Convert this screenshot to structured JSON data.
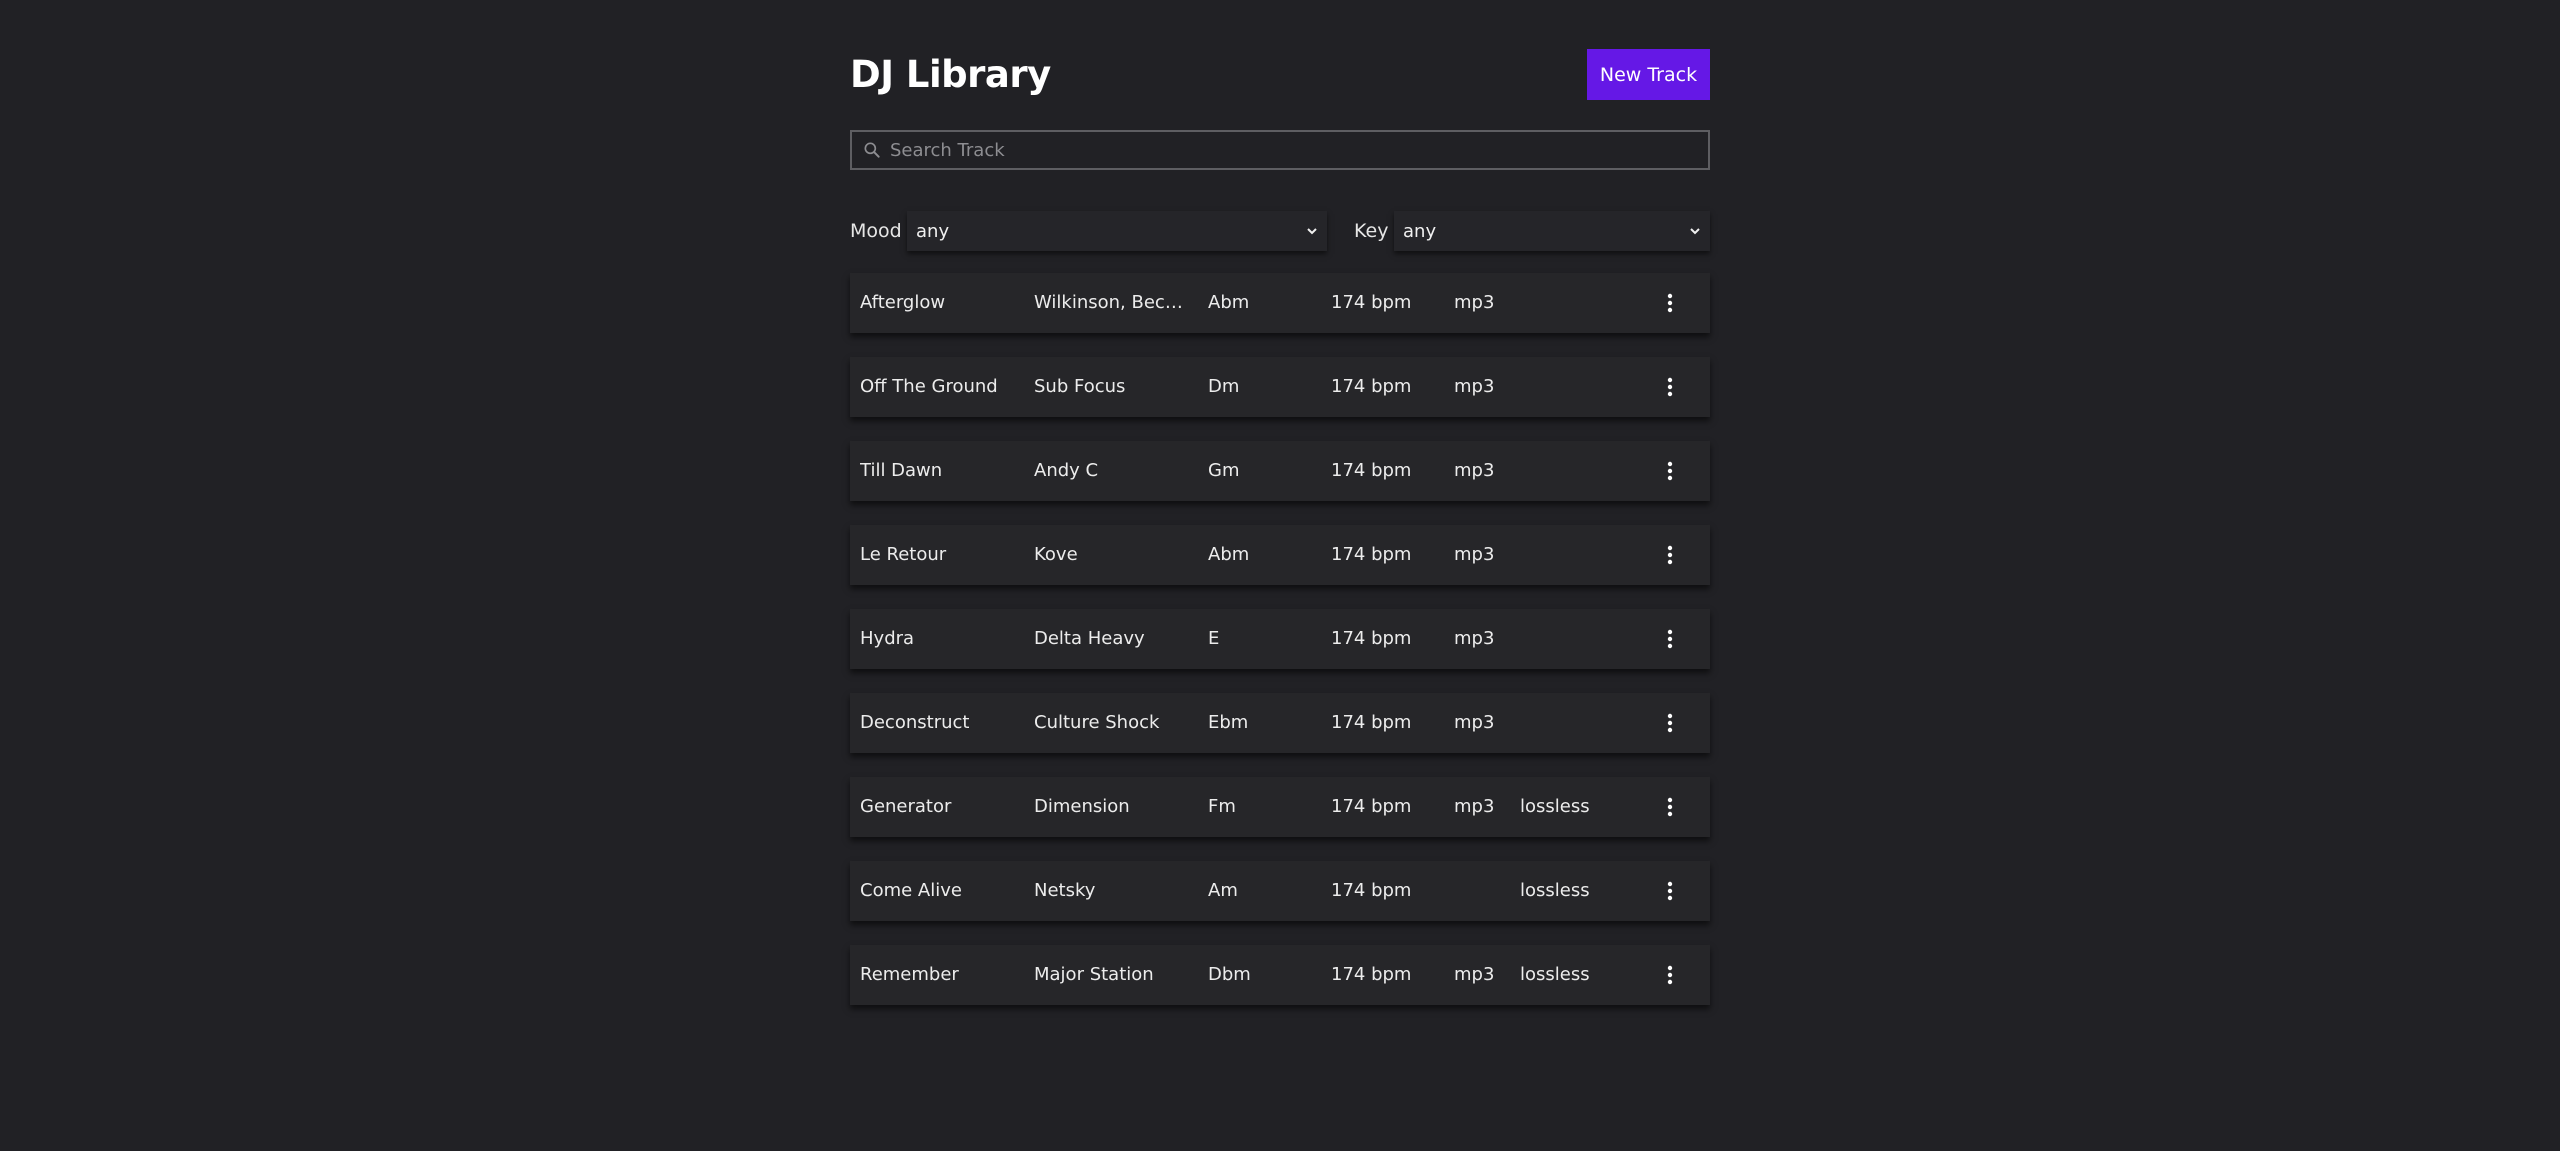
{
  "app": {
    "title": "DJ Library",
    "new_track_label": "New Track"
  },
  "search": {
    "placeholder": "Search Track",
    "value": ""
  },
  "filters": {
    "mood": {
      "label": "Mood",
      "value": "any"
    },
    "key": {
      "label": "Key",
      "value": "any"
    }
  },
  "colors": {
    "background": "#212125",
    "accent": "#6518e6",
    "row_background": "#262629"
  },
  "icons": {
    "search": "search-icon",
    "dropdown": "chevron-down-icon",
    "row_menu": "more-vertical-icon"
  },
  "tracks": [
    {
      "title": "Afterglow",
      "artist": "Wilkinson, Becky Hill",
      "key": "Abm",
      "bpm": "174 bpm",
      "format": "mp3",
      "lossless": ""
    },
    {
      "title": "Off The Ground",
      "artist": "Sub Focus",
      "key": "Dm",
      "bpm": "174 bpm",
      "format": "mp3",
      "lossless": ""
    },
    {
      "title": "Till Dawn",
      "artist": "Andy C",
      "key": "Gm",
      "bpm": "174 bpm",
      "format": "mp3",
      "lossless": ""
    },
    {
      "title": "Le Retour",
      "artist": "Kove",
      "key": "Abm",
      "bpm": "174 bpm",
      "format": "mp3",
      "lossless": ""
    },
    {
      "title": "Hydra",
      "artist": "Delta Heavy",
      "key": "E",
      "bpm": "174 bpm",
      "format": "mp3",
      "lossless": ""
    },
    {
      "title": "Deconstruct",
      "artist": "Culture Shock",
      "key": "Ebm",
      "bpm": "174 bpm",
      "format": "mp3",
      "lossless": ""
    },
    {
      "title": "Generator",
      "artist": "Dimension",
      "key": "Fm",
      "bpm": "174 bpm",
      "format": "mp3",
      "lossless": "lossless"
    },
    {
      "title": "Come Alive",
      "artist": "Netsky",
      "key": "Am",
      "bpm": "174 bpm",
      "format": "",
      "lossless": "lossless"
    },
    {
      "title": "Remember",
      "artist": "Major Station",
      "key": "Dbm",
      "bpm": "174 bpm",
      "format": "mp3",
      "lossless": "lossless"
    }
  ]
}
